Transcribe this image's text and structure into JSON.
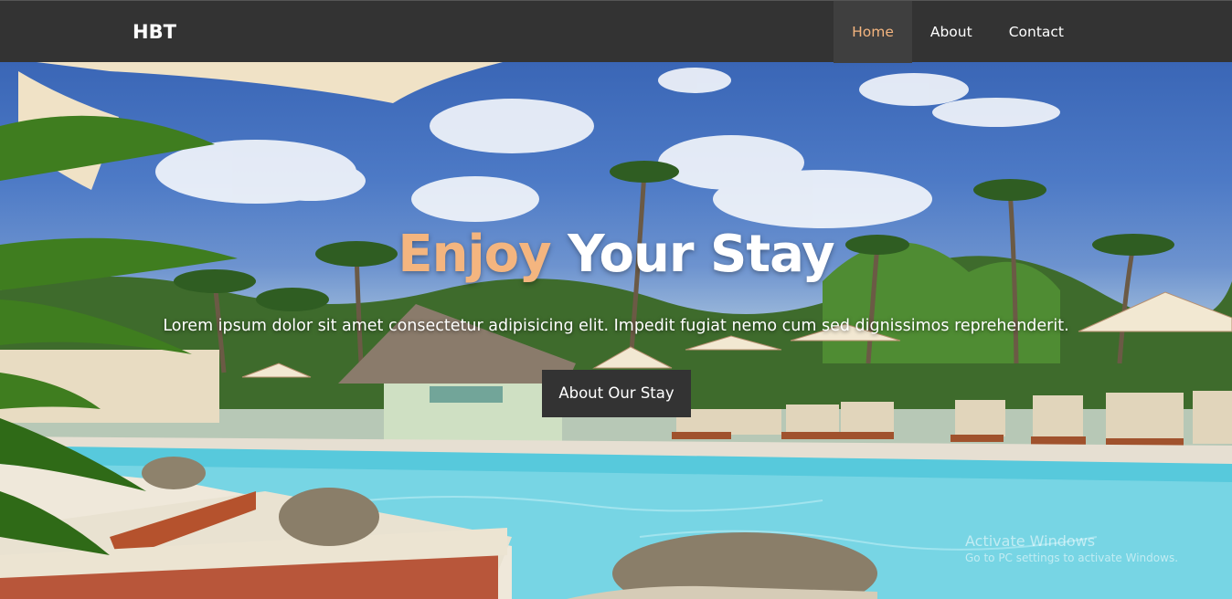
{
  "navbar": {
    "brand": "HBT",
    "items": [
      {
        "label": "Home",
        "active": true
      },
      {
        "label": "About",
        "active": false
      },
      {
        "label": "Contact",
        "active": false
      }
    ]
  },
  "hero": {
    "title_accent": "Enjoy",
    "title_rest": "Your Stay",
    "subtitle": "Lorem ipsum dolor sit amet consectetur adipisicing elit. Impedit fugiat nemo cum sed dignissimos reprehenderit.",
    "button_label": "About Our Stay"
  },
  "watermark": {
    "line1": "Activate Windows",
    "line2": "Go to PC settings to activate Windows."
  },
  "colors": {
    "navbar_bg": "#333333",
    "accent": "#f4b57f",
    "active_nav_bg": "#3f3f3f"
  }
}
